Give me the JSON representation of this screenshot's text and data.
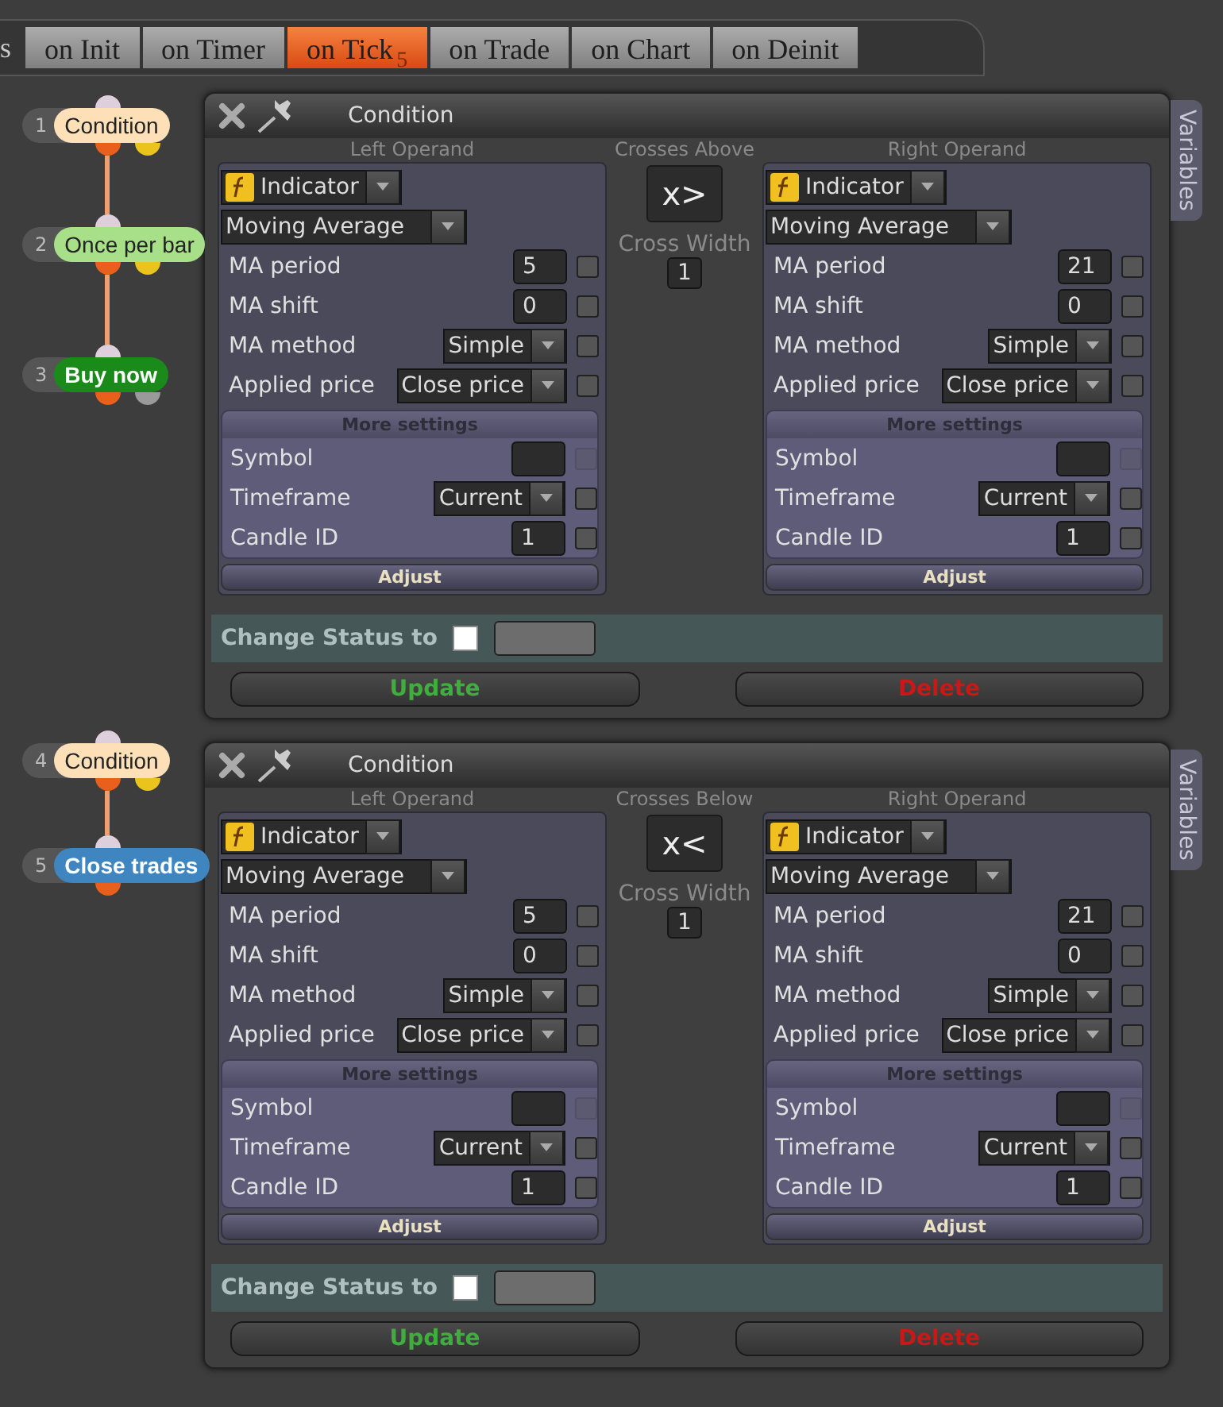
{
  "tab_bar": {
    "cut_label": "s",
    "tabs": [
      {
        "label": "on Init",
        "selected": false
      },
      {
        "label": "on Timer",
        "selected": false
      },
      {
        "label": "on Tick",
        "badge": "5",
        "selected": true
      },
      {
        "label": "on Trade",
        "selected": false
      },
      {
        "label": "on Chart",
        "selected": false
      },
      {
        "label": "on Deinit",
        "selected": false
      }
    ]
  },
  "sections": [
    {
      "nodes": [
        {
          "number": "1",
          "label": "Condition",
          "color": "#fde0b8",
          "ports": [
            {
              "color": "#e8601c"
            },
            {
              "color": "#e8c41c"
            }
          ]
        },
        {
          "number": "2",
          "label": "Once per bar",
          "color": "#a8e08a",
          "ports": [
            {
              "color": "#e8601c"
            },
            {
              "color": "#e8c41c"
            }
          ]
        },
        {
          "number": "3",
          "label": "Buy now",
          "color": "#1a8a1a",
          "ports": [
            {
              "color": "#e8601c"
            },
            {
              "color": "#9a9a9a"
            }
          ]
        }
      ],
      "panel": {
        "title": "Condition",
        "side_tab": "Variables",
        "operator": {
          "label": "Crosses Above",
          "symbol": "x>",
          "width_label": "Cross Width",
          "width_value": "1"
        },
        "operands": [
          {
            "heading": "Left Operand",
            "type": "Indicator",
            "indicator": "Moving Average",
            "params": [
              {
                "label": "MA period",
                "kind": "input",
                "value": "5",
                "checked": false
              },
              {
                "label": "MA shift",
                "kind": "input",
                "value": "0",
                "checked": false
              },
              {
                "label": "MA method",
                "kind": "select",
                "value": "Simple",
                "checked": false
              },
              {
                "label": "Applied price",
                "kind": "select",
                "value": "Close price",
                "checked": false
              }
            ],
            "more_heading": "More settings",
            "more_params": [
              {
                "label": "Symbol",
                "kind": "input",
                "checked": false,
                "disabled": true
              },
              {
                "label": "Timeframe",
                "kind": "select",
                "value": "Current",
                "checked": false,
                "disabled": false
              },
              {
                "label": "Candle ID",
                "kind": "input",
                "value": "1",
                "checked": false,
                "disabled": false
              }
            ],
            "adjust": "Adjust"
          },
          {
            "heading": "Right Operand",
            "type": "Indicator",
            "indicator": "Moving Average",
            "params": [
              {
                "label": "MA period",
                "kind": "input",
                "value": "21",
                "checked": false
              },
              {
                "label": "MA shift",
                "kind": "input",
                "value": "0",
                "checked": false
              },
              {
                "label": "MA method",
                "kind": "select",
                "value": "Simple",
                "checked": false
              },
              {
                "label": "Applied price",
                "kind": "select",
                "value": "Close price",
                "checked": false
              }
            ],
            "more_heading": "More settings",
            "more_params": [
              {
                "label": "Symbol",
                "kind": "input",
                "checked": false,
                "disabled": true
              },
              {
                "label": "Timeframe",
                "kind": "select",
                "value": "Current",
                "checked": false,
                "disabled": false
              },
              {
                "label": "Candle ID",
                "kind": "input",
                "value": "1",
                "checked": false,
                "disabled": false
              }
            ],
            "adjust": "Adjust"
          }
        ],
        "status": {
          "label": "Change Status to",
          "checked": false
        },
        "update": "Update",
        "delete": "Delete"
      }
    },
    {
      "nodes": [
        {
          "number": "4",
          "label": "Condition",
          "color": "#fde0b8",
          "ports": [
            {
              "color": "#e8601c"
            },
            {
              "color": "#e8c41c"
            }
          ]
        },
        {
          "number": "5",
          "label": "Close trades",
          "color": "#3f86c0",
          "ports": [
            {
              "color": "#e8601c"
            }
          ]
        }
      ],
      "panel": {
        "title": "Condition",
        "side_tab": "Variables",
        "operator": {
          "label": "Crosses Below",
          "symbol": "x<",
          "width_label": "Cross Width",
          "width_value": "1"
        },
        "operands": [
          {
            "heading": "Left Operand",
            "type": "Indicator",
            "indicator": "Moving Average",
            "params": [
              {
                "label": "MA period",
                "kind": "input",
                "value": "5",
                "checked": false
              },
              {
                "label": "MA shift",
                "kind": "input",
                "value": "0",
                "checked": false
              },
              {
                "label": "MA method",
                "kind": "select",
                "value": "Simple",
                "checked": false
              },
              {
                "label": "Applied price",
                "kind": "select",
                "value": "Close price",
                "checked": false
              }
            ],
            "more_heading": "More settings",
            "more_params": [
              {
                "label": "Symbol",
                "kind": "input",
                "checked": false,
                "disabled": true
              },
              {
                "label": "Timeframe",
                "kind": "select",
                "value": "Current",
                "checked": false,
                "disabled": false
              },
              {
                "label": "Candle ID",
                "kind": "input",
                "value": "1",
                "checked": false,
                "disabled": false
              }
            ],
            "adjust": "Adjust"
          },
          {
            "heading": "Right Operand",
            "type": "Indicator",
            "indicator": "Moving Average",
            "params": [
              {
                "label": "MA period",
                "kind": "input",
                "value": "21",
                "checked": false
              },
              {
                "label": "MA shift",
                "kind": "input",
                "value": "0",
                "checked": false
              },
              {
                "label": "MA method",
                "kind": "select",
                "value": "Simple",
                "checked": false
              },
              {
                "label": "Applied price",
                "kind": "select",
                "value": "Close price",
                "checked": false
              }
            ],
            "more_heading": "More settings",
            "more_params": [
              {
                "label": "Symbol",
                "kind": "input",
                "checked": false,
                "disabled": true
              },
              {
                "label": "Timeframe",
                "kind": "select",
                "value": "Current",
                "checked": false,
                "disabled": false
              },
              {
                "label": "Candle ID",
                "kind": "input",
                "value": "1",
                "checked": false,
                "disabled": false
              }
            ],
            "adjust": "Adjust"
          }
        ],
        "status": {
          "label": "Change Status to",
          "checked": false
        },
        "update": "Update",
        "delete": "Delete"
      }
    }
  ]
}
